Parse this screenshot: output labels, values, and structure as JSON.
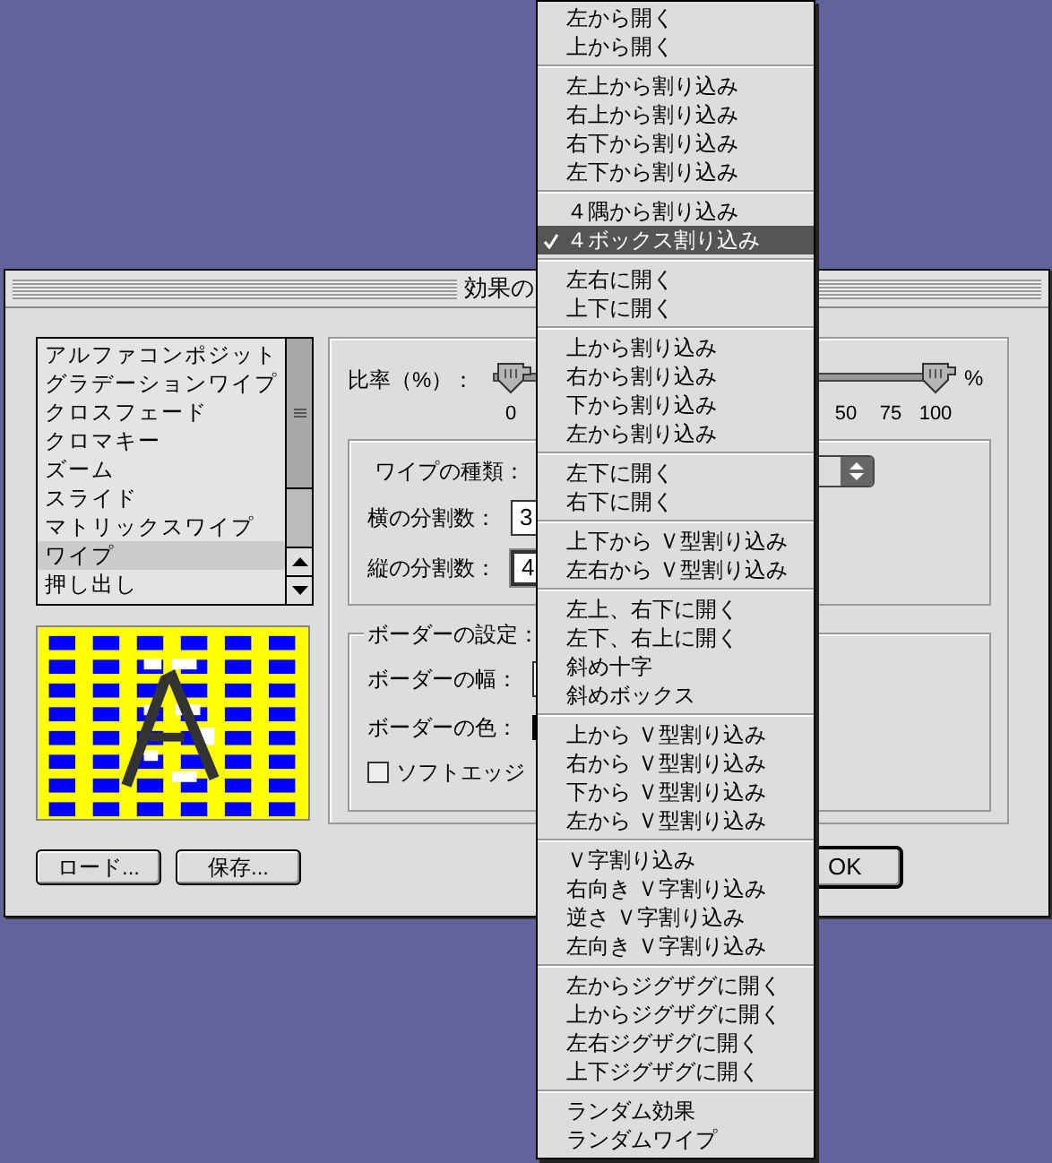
{
  "dialog": {
    "title": "効果の",
    "effect_list": {
      "items": [
        {
          "label": "アルファコンポジット",
          "selected": false
        },
        {
          "label": "グラデーションワイプ",
          "selected": false
        },
        {
          "label": "クロスフェード",
          "selected": false
        },
        {
          "label": "クロマキー",
          "selected": false
        },
        {
          "label": "ズーム",
          "selected": false
        },
        {
          "label": "スライド",
          "selected": false
        },
        {
          "label": "マトリックスワイプ",
          "selected": false
        },
        {
          "label": "ワイプ",
          "selected": true
        },
        {
          "label": "押し出し",
          "selected": false
        }
      ]
    },
    "buttons": [
      "ロード...",
      "保存..."
    ],
    "ratio": {
      "label": "比率（%）：",
      "thumbs": [
        {
          "level": 0
        },
        {
          "level": 1
        }
      ],
      "tick_labels": [
        "0",
        "50",
        "75",
        "100"
      ],
      "unit": "%"
    },
    "wipe_group": {
      "type_label": "ワイプの種類：",
      "fields": [
        {
          "label": "横の分割数：",
          "value": "3",
          "focused": false
        },
        {
          "label": "縦の分割数：",
          "value": "4",
          "focused": true
        }
      ]
    },
    "border_group": {
      "title": "ボーダーの設定：",
      "width_label": "ボーダーの幅：",
      "color_label": "ボーダーの色：",
      "soft_edge": {
        "label": "ソフトエッジ",
        "checked": false
      }
    },
    "ok_button": "OK"
  },
  "menu": {
    "groups": [
      [
        {
          "label": "左から開く",
          "selected": false
        },
        {
          "label": "上から開く",
          "selected": false
        }
      ],
      [
        {
          "label": "左上から割り込み",
          "selected": false
        },
        {
          "label": "右上から割り込み",
          "selected": false
        },
        {
          "label": "右下から割り込み",
          "selected": false
        },
        {
          "label": "左下から割り込み",
          "selected": false
        }
      ],
      [
        {
          "label": "４隅から割り込み",
          "selected": false
        },
        {
          "label": "４ボックス割り込み",
          "selected": true
        }
      ],
      [
        {
          "label": "左右に開く",
          "selected": false
        },
        {
          "label": "上下に開く",
          "selected": false
        }
      ],
      [
        {
          "label": "上から割り込み",
          "selected": false
        },
        {
          "label": "右から割り込み",
          "selected": false
        },
        {
          "label": "下から割り込み",
          "selected": false
        },
        {
          "label": "左から割り込み",
          "selected": false
        }
      ],
      [
        {
          "label": "左下に開く",
          "selected": false
        },
        {
          "label": "右下に開く",
          "selected": false
        }
      ],
      [
        {
          "label": "上下から Ｖ型割り込み",
          "selected": false
        },
        {
          "label": "左右から Ｖ型割り込み",
          "selected": false
        }
      ],
      [
        {
          "label": "左上、右下に開く",
          "selected": false
        },
        {
          "label": "左下、右上に開く",
          "selected": false
        },
        {
          "label": "斜め十字",
          "selected": false
        },
        {
          "label": "斜めボックス",
          "selected": false
        }
      ],
      [
        {
          "label": "上から Ｖ型割り込み",
          "selected": false
        },
        {
          "label": "右から Ｖ型割り込み",
          "selected": false
        },
        {
          "label": "下から Ｖ型割り込み",
          "selected": false
        },
        {
          "label": "左から Ｖ型割り込み",
          "selected": false
        }
      ],
      [
        {
          "label": "Ｖ字割り込み",
          "selected": false
        },
        {
          "label": "右向き Ｖ字割り込み",
          "selected": false
        },
        {
          "label": "逆さ Ｖ字割り込み",
          "selected": false
        },
        {
          "label": "左向き Ｖ字割り込み",
          "selected": false
        }
      ],
      [
        {
          "label": "左からジグザグに開く",
          "selected": false
        },
        {
          "label": "上からジグザグに開く",
          "selected": false
        },
        {
          "label": "左右ジグザグに開く",
          "selected": false
        },
        {
          "label": "上下ジグザグに開く",
          "selected": false
        }
      ],
      [
        {
          "label": "ランダム効果",
          "selected": false
        },
        {
          "label": "ランダムワイプ",
          "selected": false
        }
      ]
    ]
  }
}
